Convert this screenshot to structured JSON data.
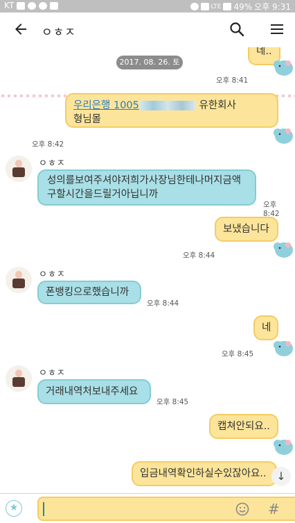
{
  "status_bar": {
    "carrier": "KT",
    "battery": "49%",
    "time": "오후 9:31",
    "network": "LTE"
  },
  "app_bar": {
    "title": "ㅇㅎㅈ",
    "back_icon": "back-arrow-icon",
    "search_icon": "search-icon",
    "menu_icon": "hamburger-menu-icon"
  },
  "date_divider": "2017. 08. 26. 토",
  "messages": [
    {
      "from": "me",
      "text": "네..",
      "time": "오후 8:41"
    },
    {
      "from": "me",
      "text_link": "우리은행 1005",
      "text_after": "유한회사",
      "text_line2": "형님몰",
      "time": "오후 8:42"
    },
    {
      "from": "them",
      "sender": "ㅇㅎㅈ",
      "text": "성의를보여주셔야저희가사장님한테나머지금액구할시간을드릴거아닙니까",
      "time": "오후 8:42"
    },
    {
      "from": "me",
      "text": "보냈습니다",
      "time": "오후 8:44"
    },
    {
      "from": "them",
      "sender": "ㅇㅎㅈ",
      "text": "폰뱅킹으로했습니까",
      "time": "오후 8:44"
    },
    {
      "from": "me",
      "text": "네",
      "time": "오후 8:45"
    },
    {
      "from": "them",
      "sender": "ㅇㅎㅈ",
      "text": "거래내역처보내주세요",
      "time": "오후 8:45"
    },
    {
      "from": "me",
      "text": "캡쳐안되요..",
      "time": ""
    },
    {
      "from": "me",
      "text": "입금내역확인하실수있잖아요..",
      "time": ""
    }
  ],
  "input_bar": {
    "emoticon_icon": "star-icon",
    "smile_icon": "smiley-icon",
    "hash_label": "#"
  },
  "colors": {
    "my_bubble": "#fce59a",
    "their_bubble": "#a9dfe6",
    "status_bar": "#bfbfbf"
  }
}
